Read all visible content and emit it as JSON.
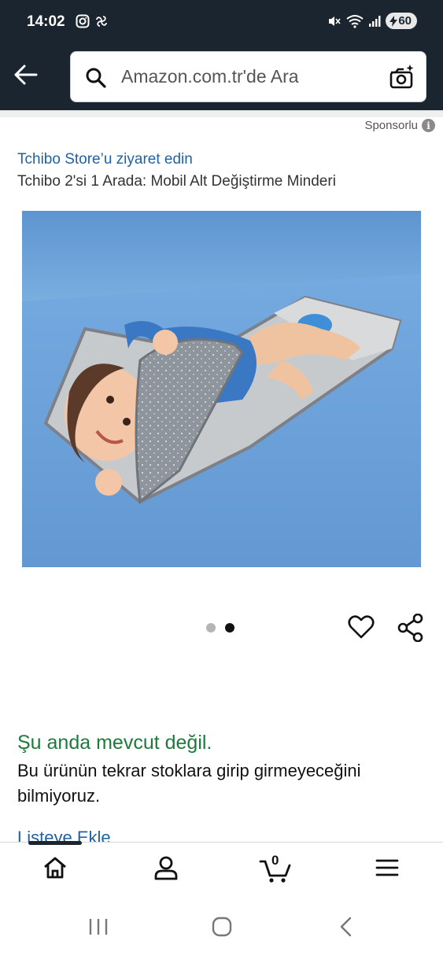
{
  "status_bar": {
    "time": "14:02",
    "battery": "60"
  },
  "search": {
    "placeholder": "Amazon.com.tr'de Ara"
  },
  "sponsored_label": "Sponsorlu",
  "product": {
    "store_link": "Tchibo Store’u ziyaret edin",
    "title": "Tchibo 2'si 1 Arada: Mobil Alt Değiştirme Minderi",
    "image_count": 2,
    "active_image": 2
  },
  "availability": {
    "status": "Şu anda mevcut değil.",
    "message": "Bu ürünün tekrar stoklara girip girmeyeceğini bilmiyoruz.",
    "add_to_list": "Listeye Ekle"
  },
  "bottom_nav": {
    "items": [
      {
        "name": "home",
        "icon": "home-icon"
      },
      {
        "name": "account",
        "icon": "person-icon"
      },
      {
        "name": "cart",
        "icon": "cart-icon",
        "count": "0"
      },
      {
        "name": "menu",
        "icon": "menu-icon"
      }
    ]
  },
  "colors": {
    "header_bg": "#1b2530",
    "link": "#2162a1",
    "in_stock_green": "#1e7a3c"
  }
}
